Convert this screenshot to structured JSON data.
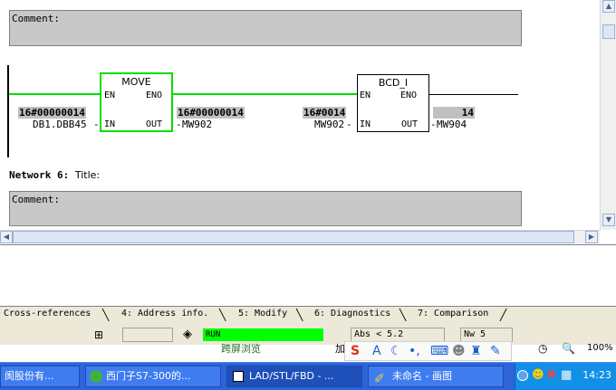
{
  "editor": {
    "comment_label_1": "Comment:",
    "comment_label_2": "Comment:",
    "rung": {
      "move": {
        "title": "MOVE",
        "en": "EN",
        "eno": "ENO",
        "in": "IN",
        "out": "OUT",
        "in_value": "16#00000014",
        "in_operand": "DB1.DBB45",
        "out_value": "16#00000014",
        "out_operand": "MW902"
      },
      "bcd": {
        "title": "BCD_I",
        "en": "EN",
        "eno": "ENO",
        "in": "IN",
        "out": "OUT",
        "in_value": "16#0014",
        "in_operand": "MW902",
        "out_value": "14",
        "out_operand": "MW904"
      }
    },
    "network6": {
      "label": "Network 6",
      "colon": ":",
      "title": "Title:"
    }
  },
  "tabs": [
    "Cross-references",
    "4: Address info.",
    "5: Modify",
    "6: Diagnostics",
    "7: Comparison"
  ],
  "status": {
    "mode": "RUN",
    "abs": "Abs < 5.2",
    "nw": "Nw 5",
    "ime_tail": "加",
    "cut_text": "跨屏浏览",
    "zoom": "100%"
  },
  "taskbar": {
    "items": [
      "阂股份有...",
      "西门子S7-300的...",
      "LAD/STL/FBD  - ...",
      "未命名 - 画图"
    ],
    "time": "14:23"
  },
  "colors": {
    "run": "#00ff00",
    "power_flow": "#00e000",
    "taskbar": "#2d64d8"
  }
}
